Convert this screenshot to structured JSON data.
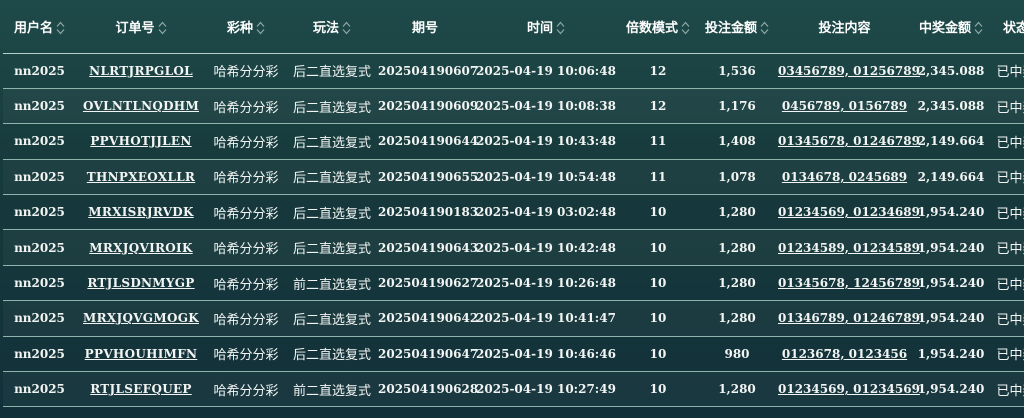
{
  "columns": [
    {
      "label": "用户名",
      "sortable": true
    },
    {
      "label": "订单号",
      "sortable": true
    },
    {
      "label": "彩种",
      "sortable": true
    },
    {
      "label": "玩法",
      "sortable": true
    },
    {
      "label": "期号",
      "sortable": false
    },
    {
      "label": "时间",
      "sortable": true
    },
    {
      "label": "倍数模式",
      "sortable": true
    },
    {
      "label": "投注金额",
      "sortable": true
    },
    {
      "label": "投注内容",
      "sortable": false
    },
    {
      "label": "中奖金额",
      "sortable": true
    },
    {
      "label": "状态",
      "sortable": false
    }
  ],
  "rows": [
    {
      "user": "nn2025",
      "order": "NLRTJRPGLOL",
      "lottery": "哈希分分彩",
      "play": "后二直选复式",
      "issue": "202504190607",
      "time": "2025-04-19 10:06:48",
      "multiple": "12",
      "amount": "1,536",
      "content": "03456789, 01256789",
      "win": "2,345.088",
      "status": "已中奖"
    },
    {
      "user": "nn2025",
      "order": "OVLNTLNQDHM",
      "lottery": "哈希分分彩",
      "play": "后二直选复式",
      "issue": "202504190609",
      "time": "2025-04-19 10:08:38",
      "multiple": "12",
      "amount": "1,176",
      "content": "0456789, 0156789",
      "win": "2,345.088",
      "status": "已中奖"
    },
    {
      "user": "nn2025",
      "order": "PPVHOTJJLEN",
      "lottery": "哈希分分彩",
      "play": "后二直选复式",
      "issue": "202504190644",
      "time": "2025-04-19 10:43:48",
      "multiple": "11",
      "amount": "1,408",
      "content": "01345678, 01246789",
      "win": "2,149.664",
      "status": "已中奖"
    },
    {
      "user": "nn2025",
      "order": "THNPXEOXLLR",
      "lottery": "哈希分分彩",
      "play": "后二直选复式",
      "issue": "202504190655",
      "time": "2025-04-19 10:54:48",
      "multiple": "11",
      "amount": "1,078",
      "content": "0134678, 0245689",
      "win": "2,149.664",
      "status": "已中奖"
    },
    {
      "user": "nn2025",
      "order": "MRXISRJRVDK",
      "lottery": "哈希分分彩",
      "play": "后二直选复式",
      "issue": "202504190183",
      "time": "2025-04-19 03:02:48",
      "multiple": "10",
      "amount": "1,280",
      "content": "01234569, 01234689",
      "win": "1,954.240",
      "status": "已中奖"
    },
    {
      "user": "nn2025",
      "order": "MRXJQVIROIK",
      "lottery": "哈希分分彩",
      "play": "后二直选复式",
      "issue": "202504190643",
      "time": "2025-04-19 10:42:48",
      "multiple": "10",
      "amount": "1,280",
      "content": "01234589, 01234589",
      "win": "1,954.240",
      "status": "已中奖"
    },
    {
      "user": "nn2025",
      "order": "RTJLSDNMYGP",
      "lottery": "哈希分分彩",
      "play": "前二直选复式",
      "issue": "202504190627",
      "time": "2025-04-19 10:26:48",
      "multiple": "10",
      "amount": "1,280",
      "content": "01345678, 12456789",
      "win": "1,954.240",
      "status": "已中奖"
    },
    {
      "user": "nn2025",
      "order": "MRXJQVGMOGK",
      "lottery": "哈希分分彩",
      "play": "后二直选复式",
      "issue": "202504190642",
      "time": "2025-04-19 10:41:47",
      "multiple": "10",
      "amount": "1,280",
      "content": "01346789, 01246789",
      "win": "1,954.240",
      "status": "已中奖"
    },
    {
      "user": "nn2025",
      "order": "PPVHOUHIMFN",
      "lottery": "哈希分分彩",
      "play": "后二直选复式",
      "issue": "202504190647",
      "time": "2025-04-19 10:46:46",
      "multiple": "10",
      "amount": "980",
      "content": "0123678, 0123456",
      "win": "1,954.240",
      "status": "已中奖"
    },
    {
      "user": "nn2025",
      "order": "RTJLSEFQUEP",
      "lottery": "哈希分分彩",
      "play": "前二直选复式",
      "issue": "202504190628",
      "time": "2025-04-19 10:27:49",
      "multiple": "10",
      "amount": "1,280",
      "content": "01234569, 01234569",
      "win": "1,954.240",
      "status": "已中奖"
    }
  ]
}
